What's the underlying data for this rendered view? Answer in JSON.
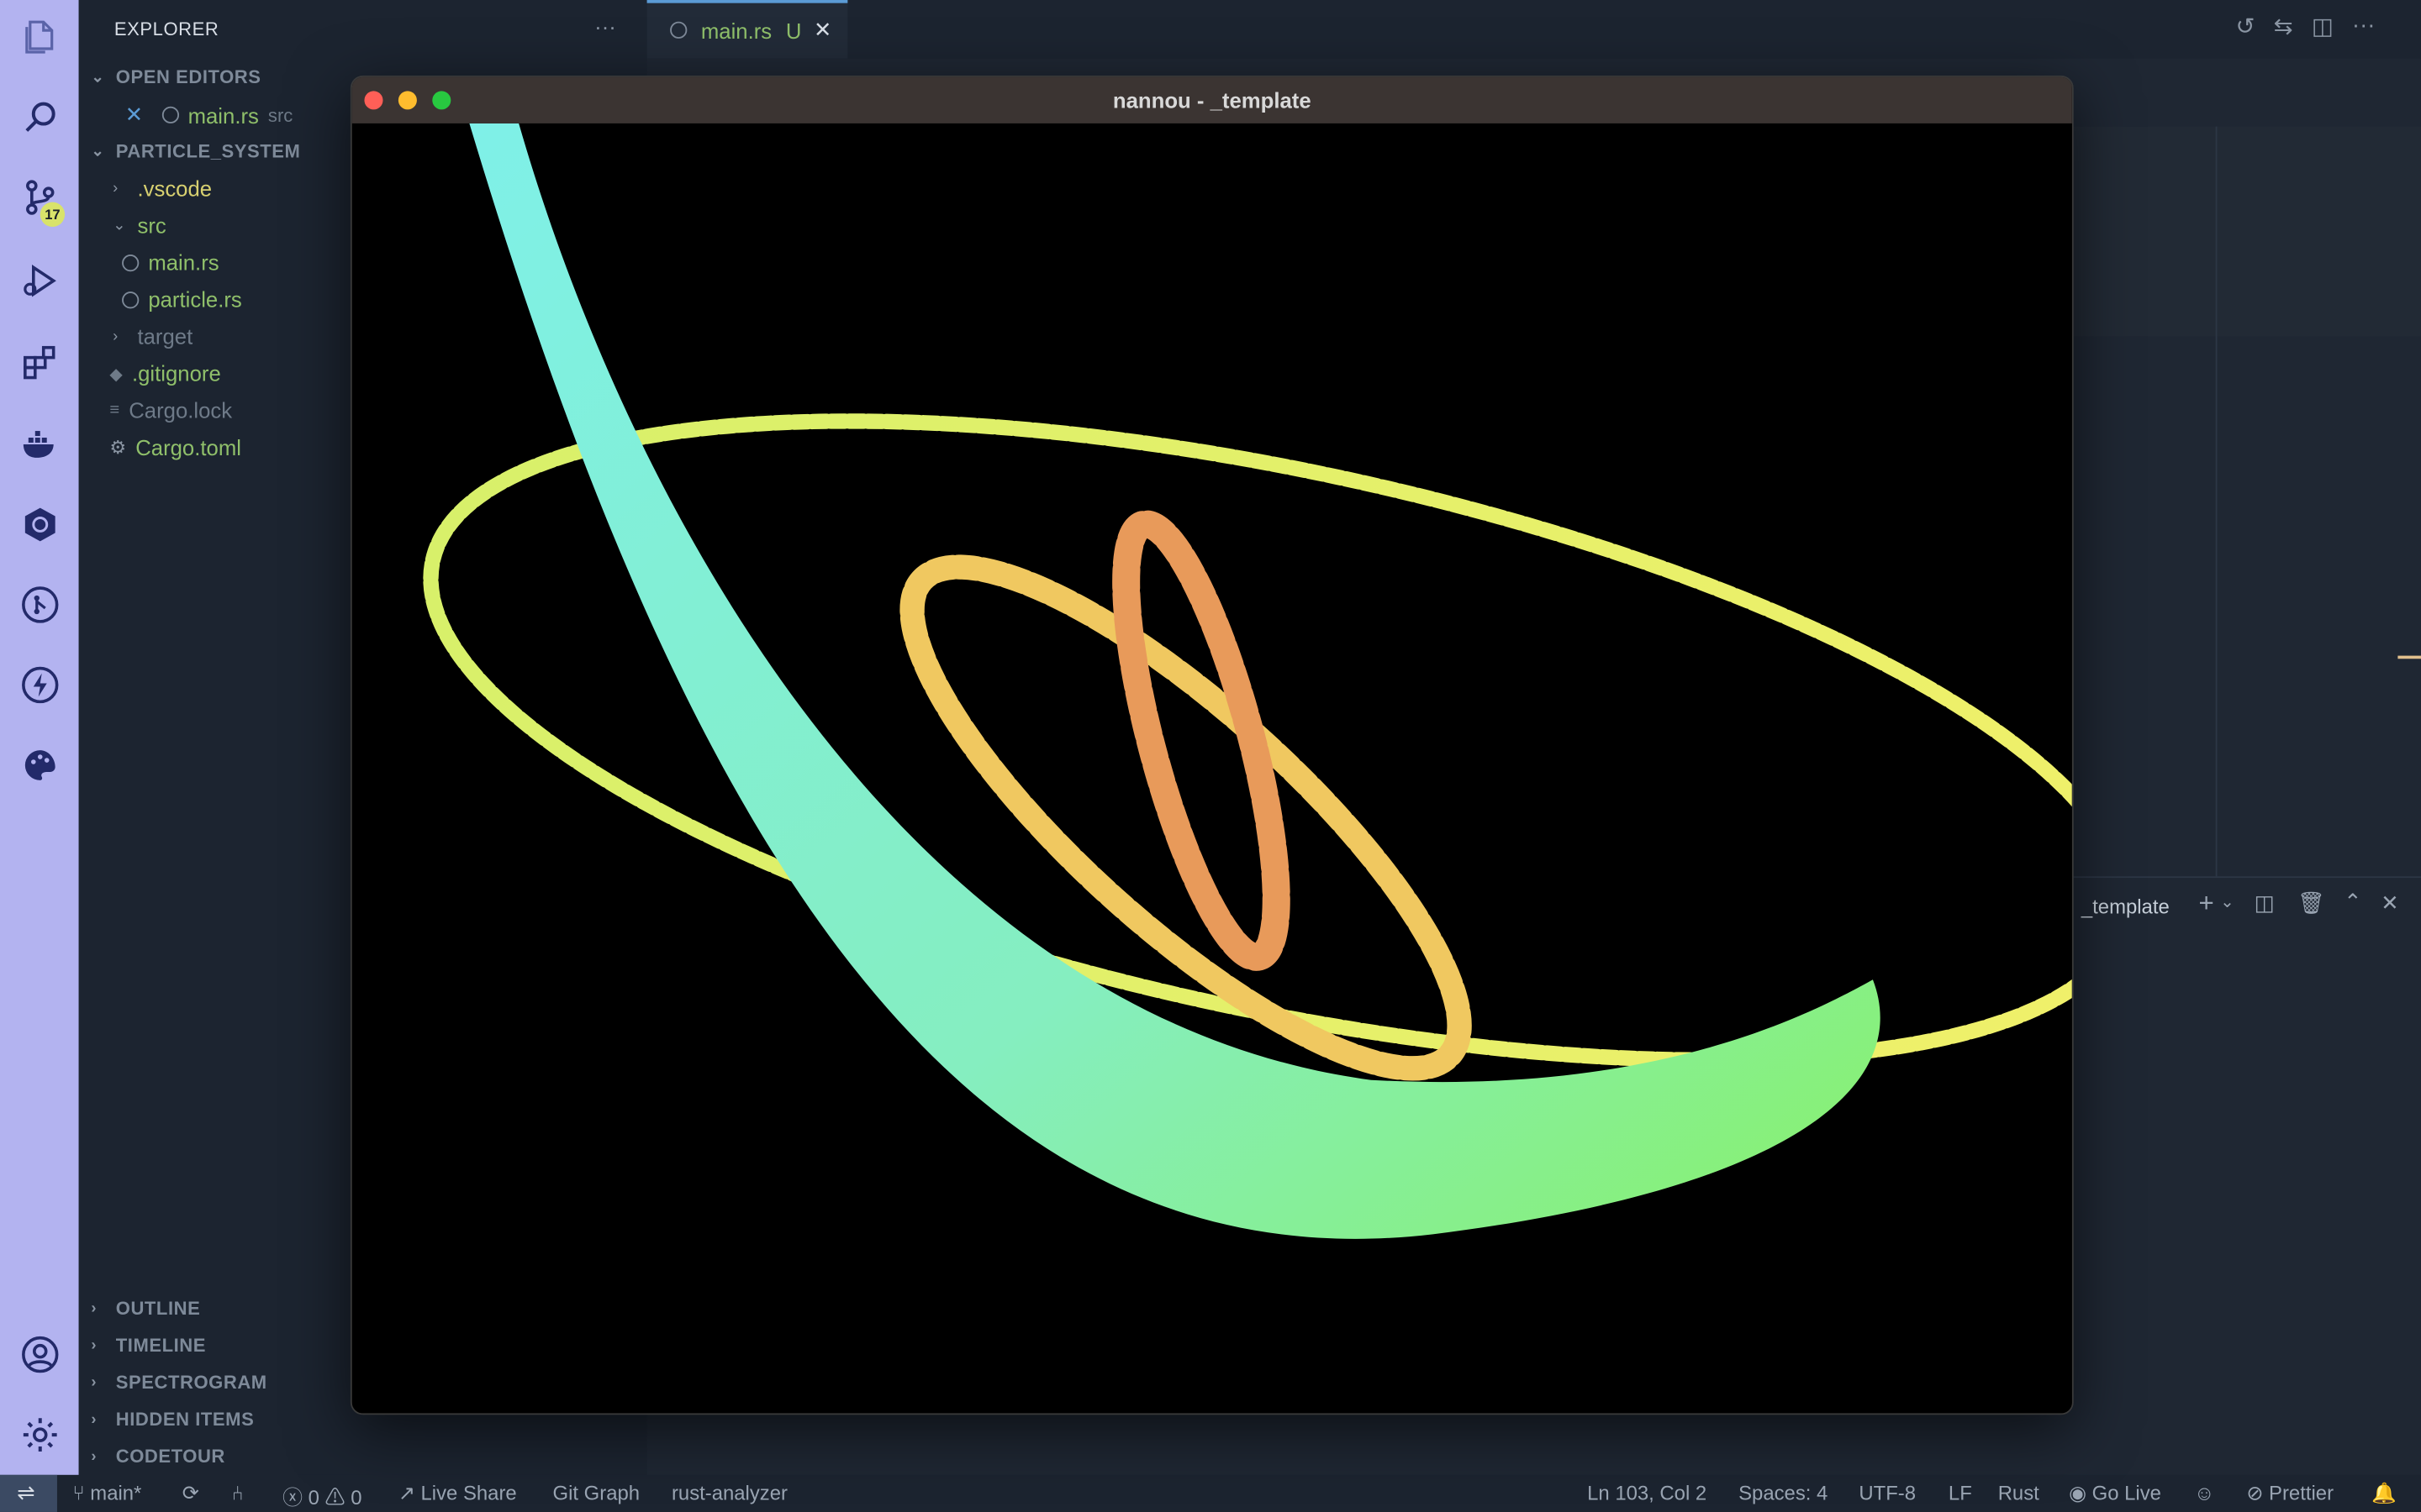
{
  "explorer": {
    "title": "EXPLORER",
    "more_icon": "ellipsis-icon",
    "open_editors": {
      "header": "OPEN EDITORS",
      "items": [
        {
          "name": "main.rs",
          "path": "src"
        }
      ]
    },
    "project": {
      "header": "PARTICLE_SYSTEM",
      "items": [
        {
          "label": ".vscode",
          "kind": "folder"
        },
        {
          "label": "src",
          "kind": "folder-open"
        },
        {
          "label": "main.rs",
          "kind": "file"
        },
        {
          "label": "particle.rs",
          "kind": "file"
        },
        {
          "label": "target",
          "kind": "folder"
        },
        {
          "label": ".gitignore",
          "kind": "file"
        },
        {
          "label": "Cargo.lock",
          "kind": "file"
        },
        {
          "label": "Cargo.toml",
          "kind": "file"
        }
      ]
    },
    "bottom_sections": [
      "OUTLINE",
      "TIMELINE",
      "SPECTROGRAM",
      "HIDDEN ITEMS",
      "CODETOUR"
    ]
  },
  "activity_bar": {
    "icons": [
      "files-icon",
      "search-icon",
      "source-control-icon",
      "run-debug-icon",
      "extensions-icon",
      "docker-icon",
      "kubernetes-icon",
      "git-graph-icon",
      "lightning-icon",
      "palette-icon"
    ],
    "source_control_badge": "17",
    "bottom_icons": [
      "account-icon",
      "settings-gear-icon"
    ]
  },
  "editor": {
    "tab": {
      "label": "main.rs",
      "status": "U"
    },
    "panel_label": "_template"
  },
  "window": {
    "title": "nannou - _template"
  },
  "status_bar": {
    "branch": "main*",
    "errors": "0",
    "warnings": "0",
    "live_share": "Live Share",
    "git_graph": "Git Graph",
    "rust_analyzer": "rust-analyzer",
    "position": "Ln 103, Col 2",
    "spaces": "Spaces: 4",
    "encoding": "UTF-8",
    "eol": "LF",
    "language": "Rust",
    "go_live": "Go Live",
    "prettier": "Prettier"
  },
  "colors": {
    "activity_bar": "#b3b3f0",
    "sidebar": "#1c2430",
    "file_green": "#8fbf6a",
    "folder_yellow": "#d7d070",
    "modified": "#e2c08d",
    "ribbon_start": "#7ff0e8",
    "ribbon_end": "#88f06a",
    "loop_yellow": "#f0f06a",
    "loop_orange": "#f0b060"
  }
}
